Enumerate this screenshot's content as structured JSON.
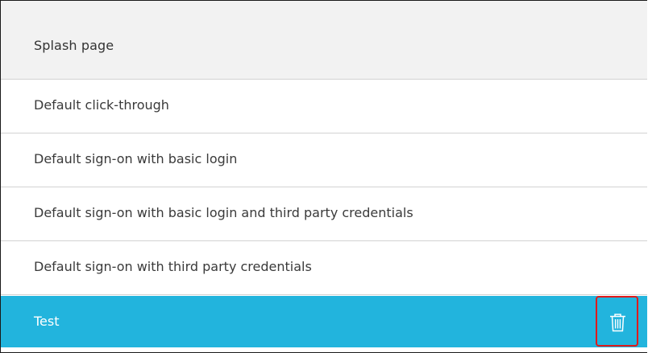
{
  "table": {
    "column_header": "Splash page",
    "rows": [
      {
        "label": "Default click-through"
      },
      {
        "label": "Default sign-on with basic login"
      },
      {
        "label": "Default sign-on with basic login and third party credentials"
      },
      {
        "label": "Default sign-on with third party credentials"
      },
      {
        "label": "Test",
        "selected": true
      }
    ]
  },
  "icons": {
    "delete": "trash-icon"
  },
  "colors": {
    "selected_row": "#22b4dd",
    "header_bg": "#f2f2f2",
    "highlight_border": "#e01a1a"
  }
}
